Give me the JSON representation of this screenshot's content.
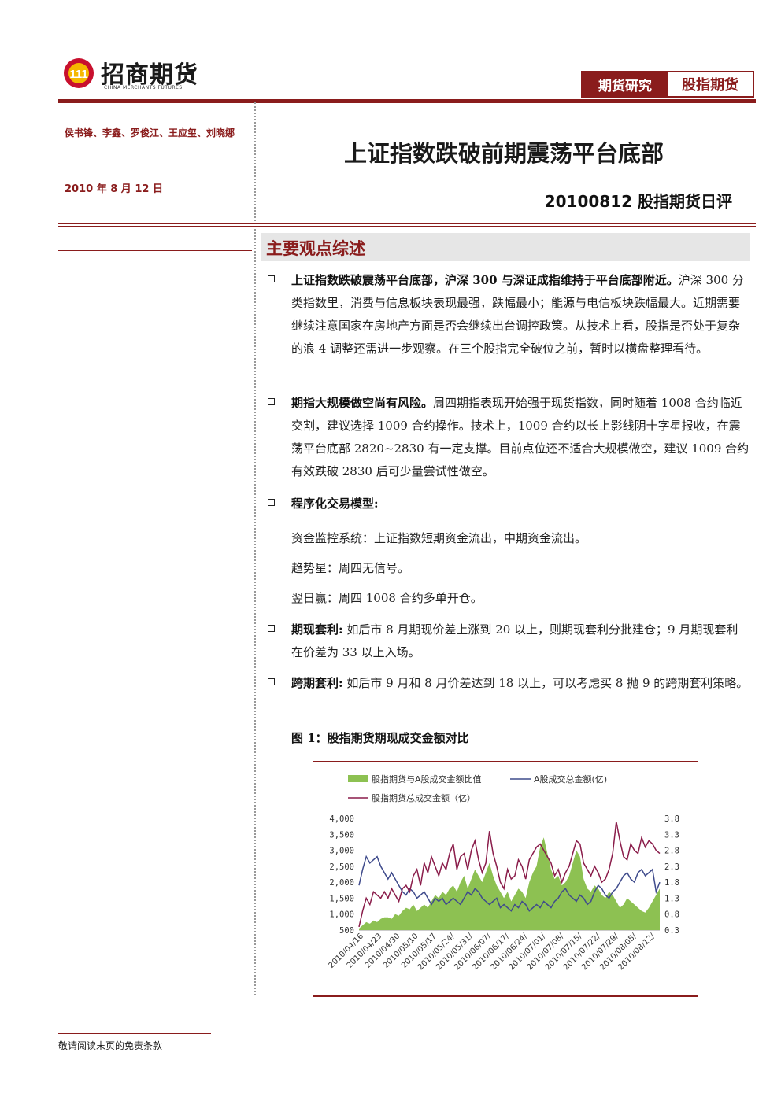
{
  "header": {
    "logo_cn": "招商期货",
    "logo_en": "CHINA MERCHANTS FUTURES",
    "tag_left": "期货研究",
    "tag_right": "股指期货",
    "brand_color": "#8a1c1c"
  },
  "meta": {
    "authors": "侯书锋、李鑫、罗俊江、王应玺、刘晓娜",
    "date": "2010 年 8 月 12 日"
  },
  "title": "上证指数跌破前期震荡平台底部",
  "subtitle": "20100812 股指期货日评",
  "section_title": "主要观点综述",
  "bullets": [
    {
      "bold": "上证指数跌破震荡平台底部，沪深 300 与深证成指维持于平台底部附近。",
      "text": "沪深 300 分类指数里，消费与信息板块表现最强，跌幅最小；能源与电信板块跌幅最大。近期需要继续注意国家在房地产方面是否会继续出台调控政策。从技术上看，股指是否处于复杂的浪 4 调整还需进一步观察。在三个股指完全破位之前，暂时以横盘整理看待。"
    },
    {
      "bold": "期指大规模做空尚有风险。",
      "text": "周四期指表现开始强于现货指数，同时随着 1008 合约临近交割，建议选择 1009 合约操作。技术上，1009 合约以长上影线阴十字星报收，在震荡平台底部 2820~2830 有一定支撑。目前点位还不适合大规模做空，建议 1009 合约有效跌破 2830 后可少量尝试性做空。"
    },
    {
      "bold": "程序化交易模型:",
      "text": ""
    }
  ],
  "model_lines": [
    "资金监控系统：上证指数短期资金流出，中期资金流出。",
    "趋势星：周四无信号。",
    "翌日赢：周四 1008 合约多单开仓。"
  ],
  "bullets2": [
    {
      "bold": "期现套利:",
      "text": " 如后市 8 月期现价差上涨到 20 以上，则期现套利分批建仓；9 月期现套利在价差为 33 以上入场。"
    },
    {
      "bold": "跨期套利:",
      "text": " 如后市 9 月和 8 月价差达到 18 以上，可以考虑买 8 抛 9 的跨期套利策略。"
    }
  ],
  "figure_title": "图 1：股指期货期现成交金额对比",
  "footer": "敬请阅读末页的免责条款",
  "chart_data": {
    "type": "line",
    "series": [
      {
        "name": "股指期货与A股成交金额比值",
        "kind": "area",
        "axis": "right",
        "color": "#8dc152",
        "values": [
          0.35,
          0.45,
          0.55,
          0.5,
          0.6,
          0.55,
          0.65,
          0.7,
          0.7,
          0.65,
          0.8,
          0.75,
          0.9,
          1.0,
          0.95,
          1.1,
          0.9,
          1.0,
          1.1,
          1.0,
          1.2,
          1.4,
          1.3,
          1.5,
          1.4,
          1.6,
          1.7,
          1.5,
          1.8,
          2.0,
          1.6,
          1.9,
          2.2,
          2.0,
          1.8,
          2.1,
          2.4,
          2.0,
          1.7,
          1.5,
          1.3,
          1.5,
          1.2,
          1.4,
          1.6,
          1.5,
          1.3,
          1.8,
          2.1,
          2.3,
          2.9,
          3.2,
          2.7,
          2.2,
          1.9,
          2.0,
          1.7,
          1.8,
          2.0,
          2.4,
          2.8,
          2.6,
          1.9,
          1.6,
          1.5,
          1.7,
          1.6,
          1.4,
          1.3,
          1.5,
          1.4,
          1.2,
          1.0,
          1.1,
          1.3,
          1.2,
          1.1,
          1.0,
          0.9,
          0.85,
          1.0,
          1.2,
          1.4,
          1.6
        ]
      },
      {
        "name": "A股成交总金额(亿)",
        "kind": "line",
        "axis": "left",
        "color": "#3f4b8c",
        "values": [
          1900,
          2400,
          2800,
          2600,
          2700,
          2800,
          2500,
          2300,
          2100,
          2300,
          2100,
          1900,
          1700,
          1600,
          1800,
          1700,
          1500,
          1600,
          1700,
          1500,
          1300,
          1500,
          1400,
          1500,
          1300,
          1400,
          1500,
          1400,
          1300,
          1500,
          1700,
          1600,
          1800,
          1700,
          1500,
          1400,
          1300,
          1400,
          1500,
          1200,
          1300,
          1200,
          1100,
          1300,
          1200,
          1400,
          1300,
          1100,
          1200,
          1300,
          1200,
          1400,
          1300,
          1200,
          1400,
          1500,
          1700,
          1800,
          1600,
          1500,
          1400,
          1600,
          1500,
          1300,
          1400,
          1700,
          1900,
          1800,
          1600,
          1500,
          1700,
          1800,
          2000,
          2200,
          2300,
          2100,
          2000,
          2300,
          2400,
          2200,
          2300,
          2400,
          1700,
          2000
        ]
      },
      {
        "name": "股指期货总成交金额（亿）",
        "kind": "line",
        "axis": "left",
        "color": "#8a1c4a",
        "values": [
          600,
          1100,
          1500,
          1300,
          1700,
          1600,
          1500,
          1700,
          1500,
          1800,
          1600,
          1400,
          1800,
          1900,
          1700,
          2200,
          2400,
          1900,
          2600,
          2300,
          2800,
          2500,
          2200,
          2600,
          2400,
          2900,
          3200,
          2400,
          2800,
          2900,
          2400,
          3000,
          3300,
          2700,
          2300,
          2600,
          3600,
          2900,
          2500,
          2000,
          1800,
          2400,
          2100,
          2200,
          2700,
          2500,
          2100,
          2700,
          2900,
          3100,
          3200,
          3000,
          2800,
          2600,
          2200,
          2400,
          2000,
          2300,
          2500,
          2900,
          3300,
          3200,
          2600,
          2400,
          2200,
          2500,
          2300,
          2000,
          2100,
          2400,
          2900,
          3900,
          3300,
          2800,
          2700,
          3200,
          3000,
          2900,
          3400,
          3100,
          3300,
          3200,
          3000,
          2900
        ]
      }
    ],
    "x_tick_labels": [
      "2010/04/16",
      "2010/04/23",
      "2010/04/30",
      "2010/05/10",
      "2010/05/17",
      "2010/05/24/",
      "2010/05/31/",
      "2010/06/07/",
      "2010/06/17/",
      "2010/06/24/",
      "2010/07/01/",
      "2010/07/08/",
      "2010/07/15/",
      "2010/07/22/",
      "2010/07/29/",
      "2010/08/05/",
      "2010/08/12/"
    ],
    "ylim_left": [
      500,
      4000
    ],
    "yticks_left": [
      "4,000",
      "3,500",
      "3,000",
      "2,500",
      "2,000",
      "1,500",
      "1,000",
      "500"
    ],
    "ylim_right": [
      0.3,
      3.8
    ],
    "yticks_right": [
      "3.8",
      "3.3",
      "2.8",
      "2.3",
      "1.8",
      "1.3",
      "0.8",
      "0.3"
    ],
    "legend_position": "top"
  }
}
